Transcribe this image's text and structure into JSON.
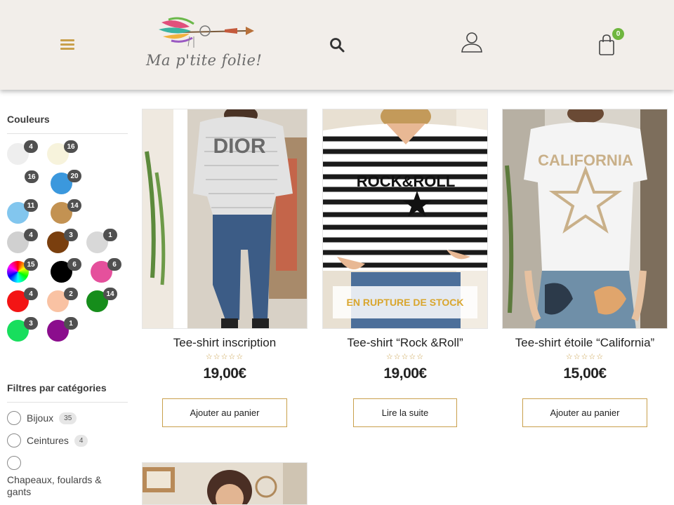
{
  "header": {
    "logo_text": "Ma p'tite folie!",
    "cart_count": "0"
  },
  "sidebar": {
    "colors_title": "Couleurs",
    "swatches": [
      {
        "color": "#eeeeee",
        "count": "4"
      },
      {
        "color": "#f7f3dc",
        "count": "16"
      },
      {
        "color": "#ffffff",
        "count": "16"
      },
      {
        "color": "#3b98dd",
        "count": "20"
      },
      {
        "color": "#82c6ee",
        "count": "11"
      },
      {
        "color": "#c39252",
        "count": "14"
      },
      {
        "color": "#d0d0d0",
        "count": "4"
      },
      {
        "color": "#7a3f0e",
        "count": "3"
      },
      {
        "color": "#d8d8d8",
        "count": "1"
      },
      {
        "color": "multicolor",
        "count": "15"
      },
      {
        "color": "#000000",
        "count": "6"
      },
      {
        "color": "#e5509c",
        "count": "6"
      },
      {
        "color": "#f31414",
        "count": "4"
      },
      {
        "color": "#f9c2a3",
        "count": "2"
      },
      {
        "color": "#168d1b",
        "count": "14"
      },
      {
        "color": "#18de5d",
        "count": "3"
      },
      {
        "color": "#8b0d8d",
        "count": "1"
      }
    ],
    "categories_title": "Filtres par catégories",
    "categories": [
      {
        "label": "Bijoux",
        "count": "35"
      },
      {
        "label": "Ceintures",
        "count": "4"
      },
      {
        "label": "Chapeaux, foulards & gants",
        "count": ""
      }
    ]
  },
  "products": [
    {
      "title": "Tee-shirt inscription",
      "price": "19,00€",
      "button": "Ajouter au panier",
      "stock_label": ""
    },
    {
      "title": "Tee-shirt “Rock &Roll”",
      "price": "19,00€",
      "button": "Lire la suite",
      "stock_label": "EN RUPTURE DE STOCK"
    },
    {
      "title": "Tee-shirt étoile “California”",
      "price": "15,00€",
      "button": "Ajouter au panier",
      "stock_label": ""
    }
  ],
  "product_images": {
    "p1_text": "DIOR",
    "p2_text": "ROCK&ROLL",
    "p3_text": "CALIFORNIA"
  },
  "rating_stars": "☆☆☆☆☆"
}
